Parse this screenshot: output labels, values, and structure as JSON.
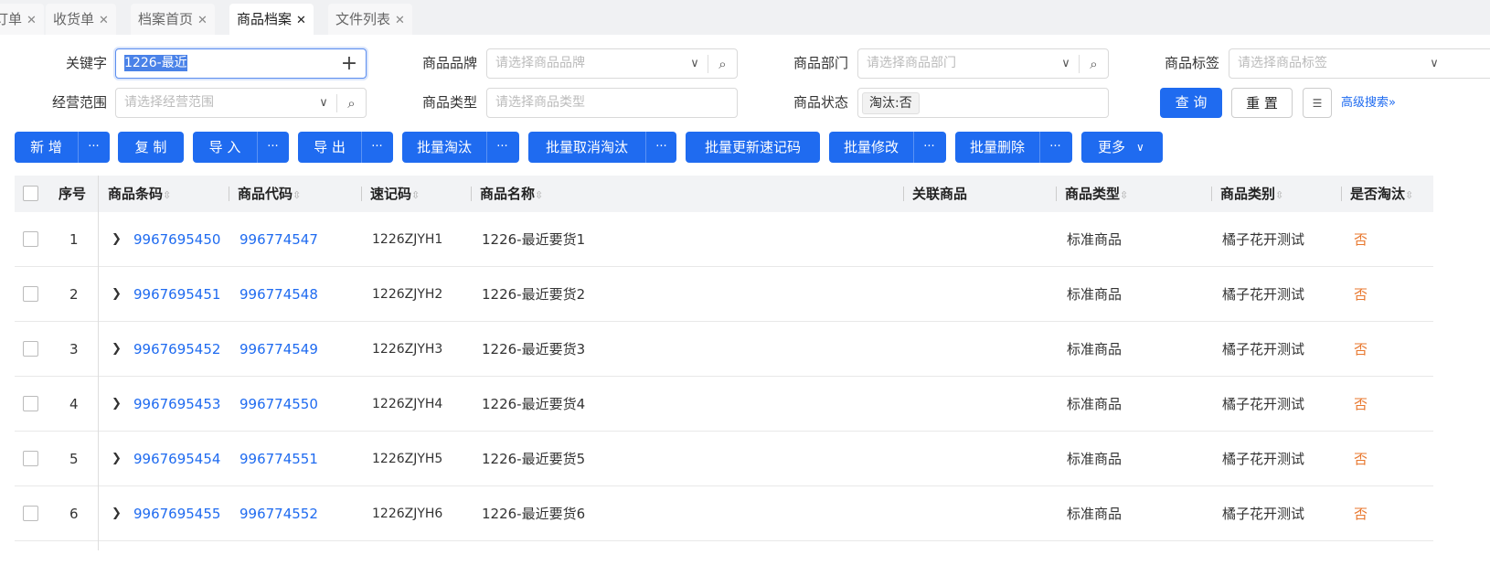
{
  "tabs": [
    {
      "label": "订单"
    },
    {
      "label": "收货单"
    },
    {
      "label": "档案首页"
    },
    {
      "label": "商品档案",
      "active": true
    },
    {
      "label": "文件列表"
    }
  ],
  "filters": {
    "keyword": {
      "label": "关键字",
      "value": "1226-最近"
    },
    "brand": {
      "label": "商品品牌",
      "placeholder": "请选择商品品牌"
    },
    "dept": {
      "label": "商品部门",
      "placeholder": "请选择商品部门"
    },
    "tag": {
      "label": "商品标签",
      "placeholder": "请选择商品标签"
    },
    "scope": {
      "label": "经营范围",
      "placeholder": "请选择经营范围"
    },
    "type": {
      "label": "商品类型",
      "placeholder": "请选择商品类型"
    },
    "status": {
      "label": "商品状态",
      "value": "淘汰:否"
    },
    "query": "查 询",
    "reset": "重 置",
    "advanced": "高级搜索"
  },
  "toolbar": {
    "add": "新 增",
    "copy": "复 制",
    "import": "导 入",
    "export": "导 出",
    "discontinue": "批量淘汰",
    "undiscontinue": "批量取消淘汰",
    "update_code": "批量更新速记码",
    "edit": "批量修改",
    "delete": "批量删除",
    "more": "更多",
    "dots": "···"
  },
  "columns": [
    "序号",
    "商品条码",
    "商品代码",
    "速记码",
    "商品名称",
    "关联商品",
    "商品类型",
    "商品类别",
    "是否淘汰"
  ],
  "rows": [
    {
      "no": "1",
      "barcode": "9967695450",
      "code": "996774547",
      "short": "1226ZJYH1",
      "name": "1226-最近要货1",
      "type": "标准商品",
      "cat": "橘子花开测试",
      "disc": "否"
    },
    {
      "no": "2",
      "barcode": "9967695451",
      "code": "996774548",
      "short": "1226ZJYH2",
      "name": "1226-最近要货2",
      "type": "标准商品",
      "cat": "橘子花开测试",
      "disc": "否"
    },
    {
      "no": "3",
      "barcode": "9967695452",
      "code": "996774549",
      "short": "1226ZJYH3",
      "name": "1226-最近要货3",
      "type": "标准商品",
      "cat": "橘子花开测试",
      "disc": "否"
    },
    {
      "no": "4",
      "barcode": "9967695453",
      "code": "996774550",
      "short": "1226ZJYH4",
      "name": "1226-最近要货4",
      "type": "标准商品",
      "cat": "橘子花开测试",
      "disc": "否"
    },
    {
      "no": "5",
      "barcode": "9967695454",
      "code": "996774551",
      "short": "1226ZJYH5",
      "name": "1226-最近要货5",
      "type": "标准商品",
      "cat": "橘子花开测试",
      "disc": "否"
    },
    {
      "no": "6",
      "barcode": "9967695455",
      "code": "996774552",
      "short": "1226ZJYH6",
      "name": "1226-最近要货6",
      "type": "标准商品",
      "cat": "橘子花开测试",
      "disc": "否"
    }
  ]
}
